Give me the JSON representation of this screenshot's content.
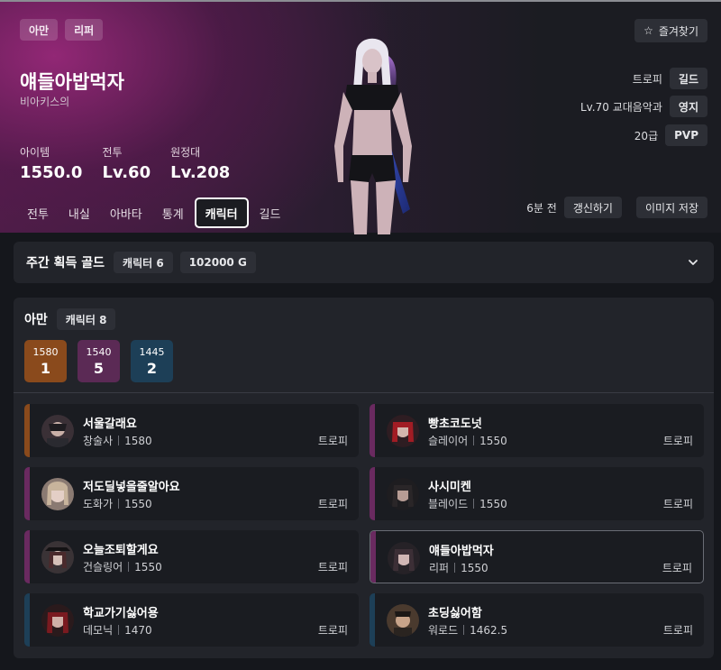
{
  "hero": {
    "tags": [
      "아만",
      "리퍼"
    ],
    "name": "얘들아밥먹자",
    "server": "비아키스의",
    "stats": [
      {
        "label": "아이템",
        "value": "1550.0"
      },
      {
        "label": "전투",
        "value": "Lv.60"
      },
      {
        "label": "원정대",
        "value": "Lv.208"
      }
    ],
    "tabs": [
      "전투",
      "내실",
      "아바타",
      "통계",
      "캐릭터",
      "길드"
    ],
    "active_tab": "캐릭터",
    "favorite_label": "즐겨찾기",
    "info_rows": [
      {
        "text": "트로피",
        "badge": "길드"
      },
      {
        "text": "Lv.70 교대음악과",
        "badge": "영지"
      },
      {
        "text": "20급",
        "badge": "PVP"
      }
    ],
    "updated": "6분 전",
    "refresh_label": "갱신하기",
    "save_image_label": "이미지 저장"
  },
  "gold": {
    "title": "주간 획득 골드",
    "character_count": "캐릭터 6",
    "amount": "102000 G"
  },
  "roster": {
    "server": "아만",
    "character_count": "캐릭터 8",
    "level_groups": [
      {
        "level": "1580",
        "count": "1",
        "color": "#8a4a1c"
      },
      {
        "level": "1540",
        "count": "5",
        "color": "#5b2a55"
      },
      {
        "level": "1445",
        "count": "2",
        "color": "#1d3f57"
      }
    ],
    "characters": [
      {
        "name": "서울갈래요",
        "class": "창술사",
        "level": "1580",
        "trophy": "트로피",
        "accent": "#8a4a1c"
      },
      {
        "name": "빵초코도넛",
        "class": "슬레이어",
        "level": "1550",
        "trophy": "트로피",
        "accent": "#6a2a60"
      },
      {
        "name": "저도딜넣을줄알아요",
        "class": "도화가",
        "level": "1550",
        "trophy": "트로피",
        "accent": "#6a2a60"
      },
      {
        "name": "사시미켄",
        "class": "블레이드",
        "level": "1550",
        "trophy": "트로피",
        "accent": "#6a2a60"
      },
      {
        "name": "오늘조퇴할게요",
        "class": "건슬링어",
        "level": "1550",
        "trophy": "트로피",
        "accent": "#6a2a60"
      },
      {
        "name": "얘들아밥먹자",
        "class": "리퍼",
        "level": "1550",
        "trophy": "트로피",
        "accent": "#6a2a60"
      },
      {
        "name": "학교가기싫어용",
        "class": "데모닉",
        "level": "1470",
        "trophy": "트로피",
        "accent": "#1d3f57"
      },
      {
        "name": "초딩싫어함",
        "class": "워로드",
        "level": "1462.5",
        "trophy": "트로피",
        "accent": "#1d3f57"
      }
    ]
  }
}
